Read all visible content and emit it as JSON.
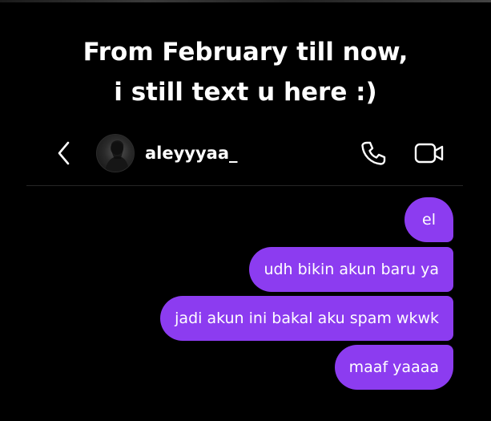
{
  "caption": {
    "line1": "From February till now,",
    "line2": "i still text u here :)"
  },
  "header": {
    "username": "aleyyyaa_",
    "back_icon": "chevron-left-icon",
    "call_icon": "phone-icon",
    "video_icon": "video-camera-icon"
  },
  "messages": [
    {
      "text": "el"
    },
    {
      "text": "udh bikin akun baru ya"
    },
    {
      "text": "jadi akun ini bakal aku spam wkwk"
    },
    {
      "text": "maaf yaaaa"
    }
  ],
  "colors": {
    "background": "#000000",
    "bubble": "#8c3cf0",
    "text": "#ffffff",
    "divider": "#262626"
  }
}
